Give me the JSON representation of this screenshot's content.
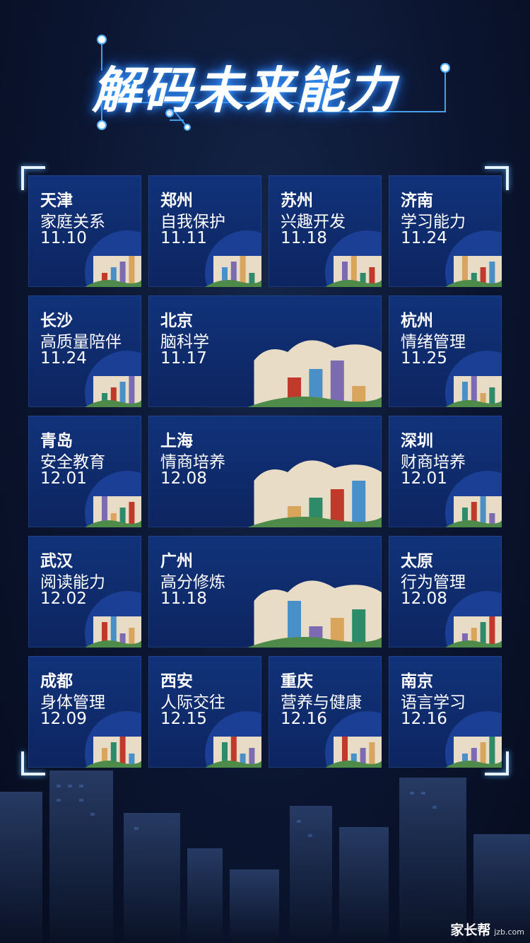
{
  "title": "解码未来能力",
  "cards": [
    {
      "city": "天津",
      "topic": "家庭关系",
      "date": "11.10"
    },
    {
      "city": "郑州",
      "topic": "自我保护",
      "date": "11.11"
    },
    {
      "city": "苏州",
      "topic": "兴趣开发",
      "date": "11.18"
    },
    {
      "city": "济南",
      "topic": "学习能力",
      "date": "11.24"
    },
    {
      "city": "长沙",
      "topic": "高质量陪伴",
      "date": "11.24"
    },
    {
      "city": "北京",
      "topic": "脑科学",
      "date": "11.17"
    },
    {
      "city": "杭州",
      "topic": "情绪管理",
      "date": "11.25"
    },
    {
      "city": "青岛",
      "topic": "安全教育",
      "date": "12.01"
    },
    {
      "city": "上海",
      "topic": "情商培养",
      "date": "12.08"
    },
    {
      "city": "深圳",
      "topic": "财商培养",
      "date": "12.01"
    },
    {
      "city": "武汉",
      "topic": "阅读能力",
      "date": "12.02"
    },
    {
      "city": "广州",
      "topic": "高分修炼",
      "date": "11.18"
    },
    {
      "city": "太原",
      "topic": "行为管理",
      "date": "12.08"
    },
    {
      "city": "成都",
      "topic": "身体管理",
      "date": "12.09"
    },
    {
      "city": "西安",
      "topic": "人际交往",
      "date": "12.15"
    },
    {
      "city": "重庆",
      "topic": "营养与健康",
      "date": "12.16"
    },
    {
      "city": "南京",
      "topic": "语言学习",
      "date": "12.16"
    }
  ],
  "watermark": {
    "brand": "家长帮",
    "domain": "jzb.com"
  },
  "colors": {
    "card": "#11327a",
    "background": "#0b1530",
    "glow": "#3aa0ff"
  }
}
